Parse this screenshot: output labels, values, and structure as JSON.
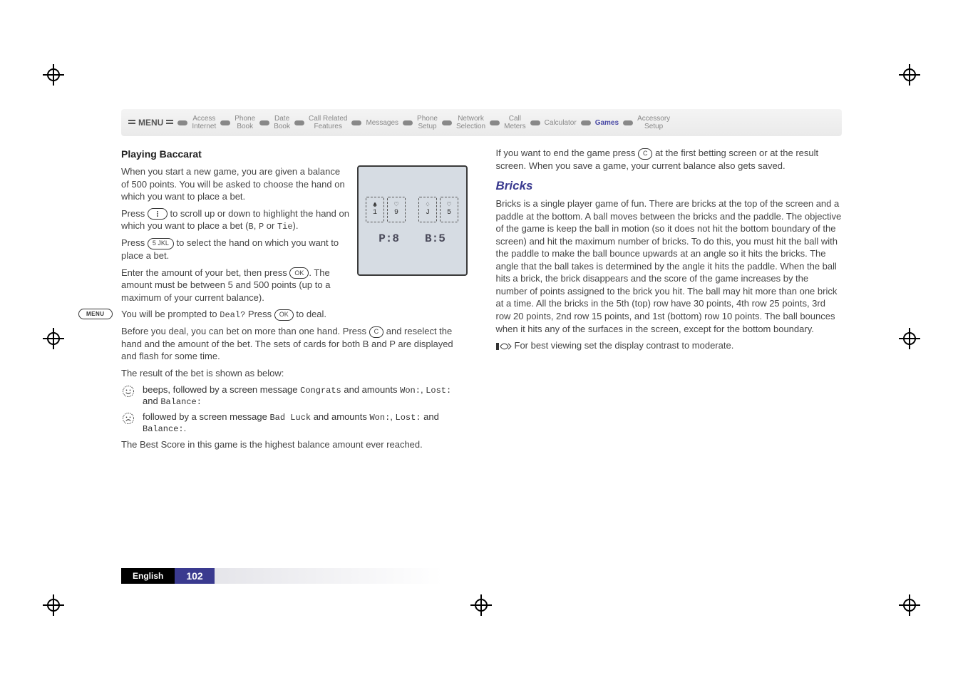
{
  "breadcrumb": {
    "menu": "MENU",
    "items": [
      "Access\nInternet",
      "Phone\nBook",
      "Date\nBook",
      "Call Related\nFeatures",
      "Messages",
      "Phone\nSetup",
      "Network\nSelection",
      "Call\nMeters",
      "Calculator",
      "Games",
      "Accessory\nSetup"
    ],
    "active_index": 9
  },
  "menu_badge": "MENU",
  "left": {
    "heading": "Playing Baccarat",
    "p1a": "When you start a new game, you are given a balance of 500 points. You will be asked to choose the hand on which you want to place a bet.",
    "p1b_a": "Press ",
    "p1b_b": " to scroll up or down to highlight the hand on which you want to place a bet (",
    "betB": "B",
    "betComma": ", ",
    "betP": "P",
    "betOr": " or ",
    "betTie": "Tie",
    "p1b_c": ").",
    "p2a": "Press ",
    "p2b": " to select the hand on which you want to place a bet.",
    "p3a": "Enter the amount of your bet, then press ",
    "p3b": ". The amount must be between 5 and 500 points (up to a maximum of your current balance).",
    "p4a": "You will be prompted to ",
    "deal_q": "Deal?",
    "p4b": " Press ",
    "p4c": " to deal.",
    "p5a": "Before you deal, you can bet on more than one hand. Press ",
    "p5b": " and reselect the hand and the amount of the bet. The sets of cards for both B and P are displayed and flash for some time.",
    "p6": "The result of the bet is shown as below:",
    "happy_a": "beeps, followed by a screen message ",
    "congrats": "Congrats",
    "happy_b": " and amounts ",
    "won": "Won:",
    "lost": "Lost:",
    "balance": "Balance:",
    "sad_a": "followed by a screen message ",
    "bad_luck": "Bad Luck",
    "sad_b": " and amounts ",
    "dot": ".",
    "comma_sp": ", ",
    "and_sp": " and ",
    "p7": "The Best Score in this game is the highest balance amount ever reached.",
    "screen": {
      "cards": [
        {
          "suit": "♣",
          "rank": "1"
        },
        {
          "suit": "♡",
          "rank": "9"
        },
        {
          "suit": "♢",
          "rank": "J"
        },
        {
          "suit": "♡",
          "rank": "5"
        }
      ],
      "p_score": "P:8",
      "b_score": "B:5"
    },
    "key_scroll_symbol": "⁝",
    "key_5": "5 JKL",
    "key_ok": "OK",
    "key_c": "C"
  },
  "right": {
    "p1a": "If you want to end the game press ",
    "p1b": " at the first betting screen or at the result screen. When you save a game, your current balance also gets saved.",
    "heading": "Bricks",
    "p2": "Bricks is a single player game of fun. There are bricks at the top of the screen and a paddle at the bottom. A ball moves between the bricks and the paddle. The objective of the game is keep the ball in motion (so it does not hit the bottom boundary of the screen) and hit the maximum number of bricks. To do this, you must hit the ball with the paddle to make the ball bounce upwards at an angle so it hits the bricks. The angle that the ball takes is determined by the angle it hits the paddle. When the ball hits a brick, the brick disappears and the score of the game increases by the number of points assigned to the brick you hit. The ball may hit more than one brick at a time. All the bricks in the 5th (top) row have 30 points, 4th row 25 points, 3rd row 20 points, 2nd row 15 points, and 1st (bottom) row 10 points. The ball bounces when it hits any of the surfaces in the screen, except for the bottom boundary.",
    "note": "For best viewing set the display contrast to moderate.",
    "key_c": "C"
  },
  "footer": {
    "language": "English",
    "page": "102"
  }
}
